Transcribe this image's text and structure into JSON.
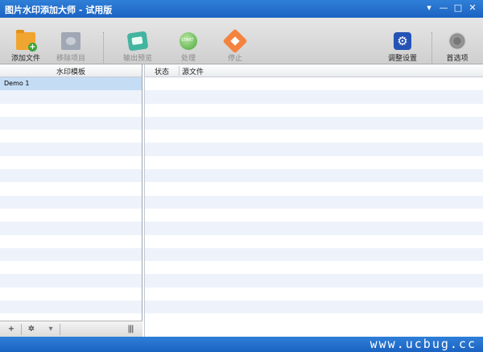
{
  "window": {
    "title": "图片水印添加大师 - 试用版",
    "controls": [
      "▾",
      "—",
      "□",
      "✕"
    ]
  },
  "toolbar": {
    "add_file": "添加文件",
    "remove_item": "移除项目",
    "output_preview": "输出预览",
    "process": "处理",
    "stop": "停止",
    "adjust_settings": "调整设置",
    "preferences": "首选项"
  },
  "left_panel": {
    "header": "水印模板",
    "items": [
      "Demo 1"
    ]
  },
  "right_panel": {
    "columns": {
      "status": "状态",
      "source_file": "源文件"
    }
  },
  "left_footer": {
    "add": "+",
    "gear": "✲",
    "dropdown": "▾",
    "columns": "|||"
  },
  "watermark": "www.ucbug.cc",
  "colors": {
    "titlebar": "#1c63c2",
    "selection": "#c5dcf5",
    "stripe": "#eef3fb"
  }
}
